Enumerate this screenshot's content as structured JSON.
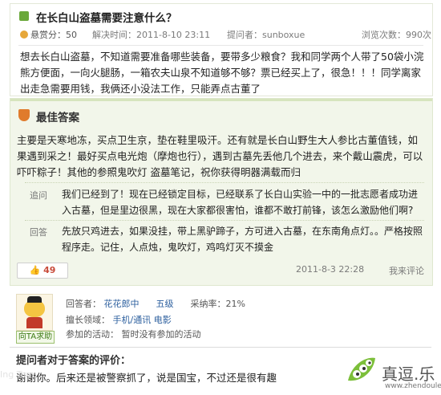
{
  "question": {
    "title": "在长白山盗墓需要注意什么？",
    "reward_label": "悬赏分：50",
    "solved_time": "解决时间：2011-8-10 23:11",
    "asker": "提问者：sunboxue",
    "views": "浏览次数：990次",
    "body": "想去长白山盗墓，不知道需要准备哪些装备，要带多少粮食？我和同学两个人带了50袋小浣熊方便面，一向火腿肠，一箱农夫山泉不知道够不够？票已经买上了，很急！！！同学离家出走急需要用钱，我俩还小没法工作，只能弄点古董了"
  },
  "best_answer": {
    "heading": "最佳答案",
    "body": "主要是天寒地冻，买点卫生京，垫在鞋里吸汗。还有就是长白山野生大人参比古董值钱，如果遇到采之！最好买点电光炮（摩炮也行），遇到古墓先丢他几个进去，来个戴山震虎，可以吓吓粽子！其他的参照鬼吹灯 盗墓笔记，祝你获得明器满载而归",
    "followup_label": "追问",
    "followup_text": "我们已经到了！现在已经锁定目标，已经联系了长白山实验一中的一批志愿者成功进入古墓，但是里边很黑，现在大家都很害怕，谁都不敢打前锋，该怎么激励他们啊?",
    "reply_label": "回答",
    "reply_text": "先放只鸡进去，如果没挂，带上黑驴蹄子，方可进入古墓，在东南角点灯。。严格按照程序走。记住，人点烛，鬼吹灯，鸡鸣灯灭不摸金",
    "like_count": "49",
    "time": "2011-8-3 22:28",
    "review_link": "我来评论"
  },
  "answerer": {
    "help_button": "向TA求助",
    "name_label": "回答者：",
    "name": "花花郎中",
    "level": "五级",
    "adopt_rate": "采纳率：21%",
    "expertise_label": "擅长领域：",
    "expertise": "手机/通讯  电影",
    "activities": "参加的活动：  暂时没有参加的活动"
  },
  "asker_comment": {
    "title": "提问者对于答案的评价：",
    "text": "谢谢你。后来还是被警察抓了，说是国宝，不过还是很有趣"
  },
  "watermark": {
    "brand": "真逗.乐",
    "domain": "www.zhendoule.com",
    "corner": "Ing Tom"
  },
  "colors": {
    "question_icon": "#6aa83a",
    "answer_bg": "#f2f6ea",
    "link": "#2c5f9e",
    "like": "#c84b3a"
  }
}
